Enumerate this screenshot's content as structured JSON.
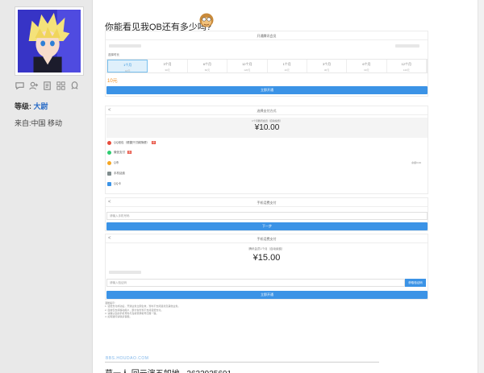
{
  "sidebar": {
    "level_label": "等级:",
    "level_value": "大尉",
    "origin": "来自:中国 移动"
  },
  "post": {
    "title": "你能看见我QB还有多少吗?"
  },
  "panel1": {
    "header": "开通腾讯会员",
    "sub_label": "选择时长",
    "tabs": [
      {
        "label": "1个月",
        "sub": "10元"
      },
      {
        "label": "3个月",
        "sub": "30元"
      },
      {
        "label": "6个月",
        "sub": "60元"
      },
      {
        "label": "12个月",
        "sub": "120元"
      },
      {
        "label": "1个月",
        "sub": "10元"
      },
      {
        "label": "3个月",
        "sub": "30元"
      },
      {
        "label": "6个月",
        "sub": "60元"
      },
      {
        "label": "12个月",
        "sub": "120元"
      }
    ],
    "price": "10元",
    "confirm": "立即开通"
  },
  "panel2": {
    "header": "选择支付方式",
    "caption": "1个月腾讯会员（自动续费）",
    "amount": "¥10.00",
    "methods": [
      {
        "label": "QQ钱包（便捷只付款随便）",
        "color": "#e74c3c"
      },
      {
        "label": "微信支付",
        "color": "#2ecc71"
      },
      {
        "label": "Q币",
        "color": "#f5a623"
      },
      {
        "label": "手机话费",
        "color": "#7f8c8d"
      },
      {
        "label": "QQ卡",
        "color": "#3b93e6"
      }
    ],
    "method_note": "余额0.00"
  },
  "panel3": {
    "header": "手机话费支付",
    "placeholder": "请输入手机号码",
    "next": "下一步"
  },
  "panel4": {
    "header": "手机话费支付",
    "caption": "腾讯会员1个月（自动续费）",
    "amount": "¥15.00",
    "code_placeholder": "请输入验证码",
    "get_code": "获取验证码",
    "confirm": "立即开通"
  },
  "notes": {
    "title": "温馨提示：",
    "lines": [
      "1. 话费支付成功后，开通业务立即生效，暂时不支持退款及其他业务。",
      "2. 目前仅支持移动用户，部分省份暂不支持话费支付。",
      "3. 请确认您的手机号码与当前登录帐号归属一致。",
      "4. 如有疑问请联系客服。"
    ]
  },
  "watermark": "BBS.HOUDAO.COM",
  "signature": "莫一人    回元演五如地~   2633935601"
}
